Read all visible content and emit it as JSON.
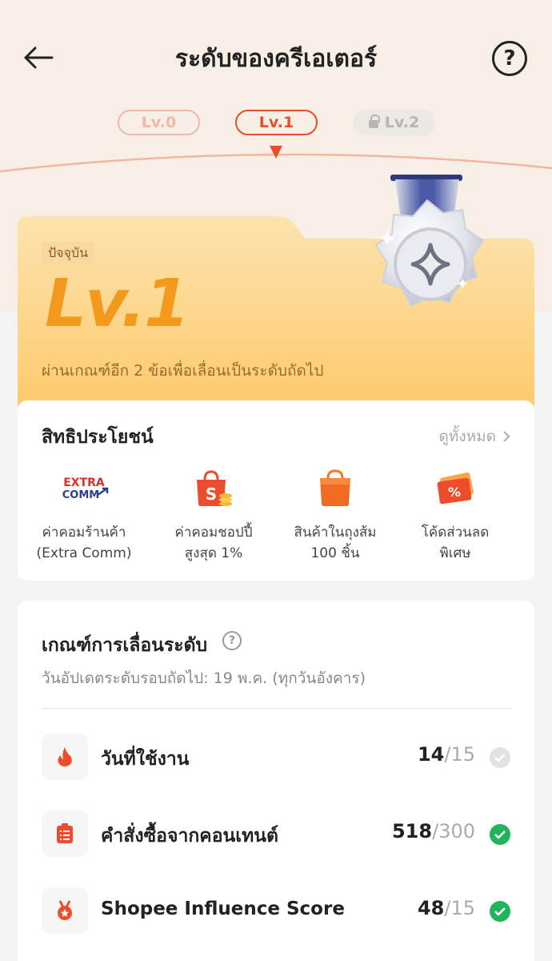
{
  "header": {
    "title": "ระดับของครีเอเตอร์",
    "help_symbol": "?"
  },
  "levels": [
    {
      "label": "Lv.0",
      "state": "passed"
    },
    {
      "label": "Lv.1",
      "state": "current"
    },
    {
      "label": "Lv.2",
      "state": "locked"
    }
  ],
  "level_card": {
    "current_badge": "ปัจจุบัน",
    "level": "Lv.1",
    "progress_text": "ผ่านเกณฑ์อีก 2 ข้อเพื่อเลื่อนเป็นระดับถัดไป"
  },
  "benefits": {
    "title": "สิทธิประโยชน์",
    "see_all": "ดูทั้งหมด",
    "items": [
      {
        "line1": "ค่าคอมร้านค้า",
        "line2": "(Extra Comm)",
        "icon": "extra-comm-logo",
        "logo_text_1": "EXTRA",
        "logo_text_2": "COMM"
      },
      {
        "line1": "ค่าคอมชอปปี้",
        "line2": "สูงสุด 1%",
        "icon": "shopee-bag-coins-icon"
      },
      {
        "line1": "สินค้าในถุงส้ม",
        "line2": "100 ชิ้น",
        "icon": "orange-bag-icon"
      },
      {
        "line1": "โค้ดส่วนลด",
        "line2": "พิเศษ",
        "icon": "voucher-icon"
      }
    ]
  },
  "criteria": {
    "title": "เกณฑ์การเลื่อนระดับ",
    "help_symbol": "?",
    "update_text": "วันอัปเดตระดับรอบถัดไป: 19 พ.ค. (ทุกวันอังคาร)",
    "rows": [
      {
        "label": "วันที่ใช้งาน",
        "current": "14",
        "separator": "/",
        "target": "15",
        "met": false,
        "icon": "flame-icon"
      },
      {
        "label": "คำสั่งซื้อจากคอนเทนต์",
        "current": "518",
        "separator": "/",
        "target": "300",
        "met": true,
        "icon": "order-list-icon"
      },
      {
        "label": "Shopee Influence Score",
        "current": "48",
        "separator": "/",
        "target": "15",
        "met": true,
        "icon": "medal-icon"
      }
    ]
  },
  "colors": {
    "brand": "#e84d2a",
    "level_gold": "#f39a1c",
    "success": "#21b45a"
  }
}
